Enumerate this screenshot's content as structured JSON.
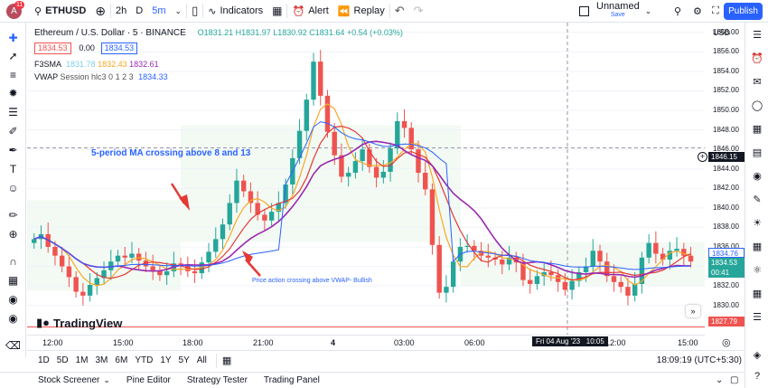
{
  "topbar": {
    "avatar_letter": "A",
    "notification_count": "11",
    "symbol": "ETHUSD",
    "interval_2h": "2h",
    "interval_d": "D",
    "interval_5m": "5m",
    "indicators_label": "Indicators",
    "alert_label": "Alert",
    "replay_label": "Replay",
    "layout_name": "Unnamed",
    "layout_status": "Save",
    "publish_label": "Publish"
  },
  "legend": {
    "title": "Ethereum / U.S. Dollar · 5 · BINANCE",
    "ohlc_o": "O1831.21",
    "ohlc_h": "H1831.97",
    "ohlc_l": "L1830.92",
    "ohlc_c": "C1831.64",
    "change": "+0.54 (+0.03%)",
    "sell_price": "1834.53",
    "spread": "0.00",
    "buy_price": "1834.53",
    "indicator1_name": "F3SMA",
    "sma1": "1831.78",
    "sma2": "1832.43",
    "sma3": "1832.61",
    "indicator2_name": "VWAP",
    "indicator2_params": "Session hlc3 0 1 2 3",
    "vwap_value": "1834.33"
  },
  "annotations": {
    "ma_cross": "5-period MA crossing above 8 and 13",
    "vwap_cross": "Price action crossing above VWAP- Bullish"
  },
  "watermark": "TradingView",
  "price_axis": {
    "currency": "USD",
    "ticks": [
      "1858.00",
      "1856.00",
      "1854.00",
      "1852.00",
      "1850.00",
      "1848.00",
      "1846.00",
      "1844.00",
      "1842.00",
      "1840.00",
      "1838.00",
      "1836.00",
      "1834.00",
      "1832.00",
      "1830.00",
      "1828.00"
    ],
    "crosshair_price": "1846.15",
    "vwap_label": "1834.76",
    "last_price": "1834.53",
    "countdown": "00:41",
    "low_line": "1827.79"
  },
  "time_axis": {
    "ticks": [
      "12:00",
      "15:00",
      "18:00",
      "21:00",
      "4",
      "03:00",
      "06:00",
      "12:00",
      "15:00"
    ],
    "crosshair_time": "Fri 04 Aug '23   10:05"
  },
  "ranges": [
    "1D",
    "5D",
    "1M",
    "3M",
    "6M",
    "YTD",
    "1Y",
    "5Y",
    "All"
  ],
  "clock": "18:09:19 (UTC+5:30)",
  "footer_tabs": [
    "Stock Screener",
    "Pine Editor",
    "Strategy Tester",
    "Trading Panel"
  ],
  "colors": {
    "up": "#26a69a",
    "down": "#ef5350",
    "sma5": "#f9a825",
    "sma8": "#e53935",
    "sma13": "#9c27b0",
    "vwap": "#2962ff",
    "accent": "#2962ff",
    "annotation": "#2962ff"
  },
  "chart_data": {
    "type": "candlestick",
    "ylim": [
      1827,
      1859
    ],
    "close_series": [
      1836.8,
      1837.3,
      1836.0,
      1835.1,
      1834.0,
      1832.9,
      1831.4,
      1831.0,
      1832.1,
      1832.8,
      1833.6,
      1834.5,
      1835.1,
      1834.9,
      1835.3,
      1834.6,
      1834.0,
      1833.6,
      1833.1,
      1833.5,
      1834.3,
      1834.1,
      1833.5,
      1833.3,
      1834.4,
      1835.5,
      1836.8,
      1838.3,
      1840.5,
      1842.8,
      1841.7,
      1840.5,
      1839.3,
      1838.7,
      1839.6,
      1840.5,
      1842.4,
      1845.1,
      1847.9,
      1851.1,
      1855.0,
      1851.5,
      1847.8,
      1845.4,
      1843.2,
      1843.6,
      1844.8,
      1846.0,
      1844.2,
      1843.1,
      1843.7,
      1846.1,
      1848.9,
      1848.2,
      1846.0,
      1843.6,
      1841.9,
      1836.2,
      1831.3,
      1831.9,
      1834.5,
      1836.0,
      1836.1,
      1835.6,
      1835.1,
      1834.9,
      1834.7,
      1834.2,
      1834.9,
      1834.4,
      1832.6,
      1832.2,
      1833.0,
      1833.4,
      1833.1,
      1832.4,
      1831.6,
      1832.5,
      1833.4,
      1834.0,
      1835.6,
      1834.5,
      1833.0,
      1832.4,
      1831.9,
      1831.0,
      1832.2,
      1834.9,
      1836.4,
      1835.3,
      1834.7,
      1835.6,
      1835.8,
      1835.1,
      1834.5
    ]
  }
}
